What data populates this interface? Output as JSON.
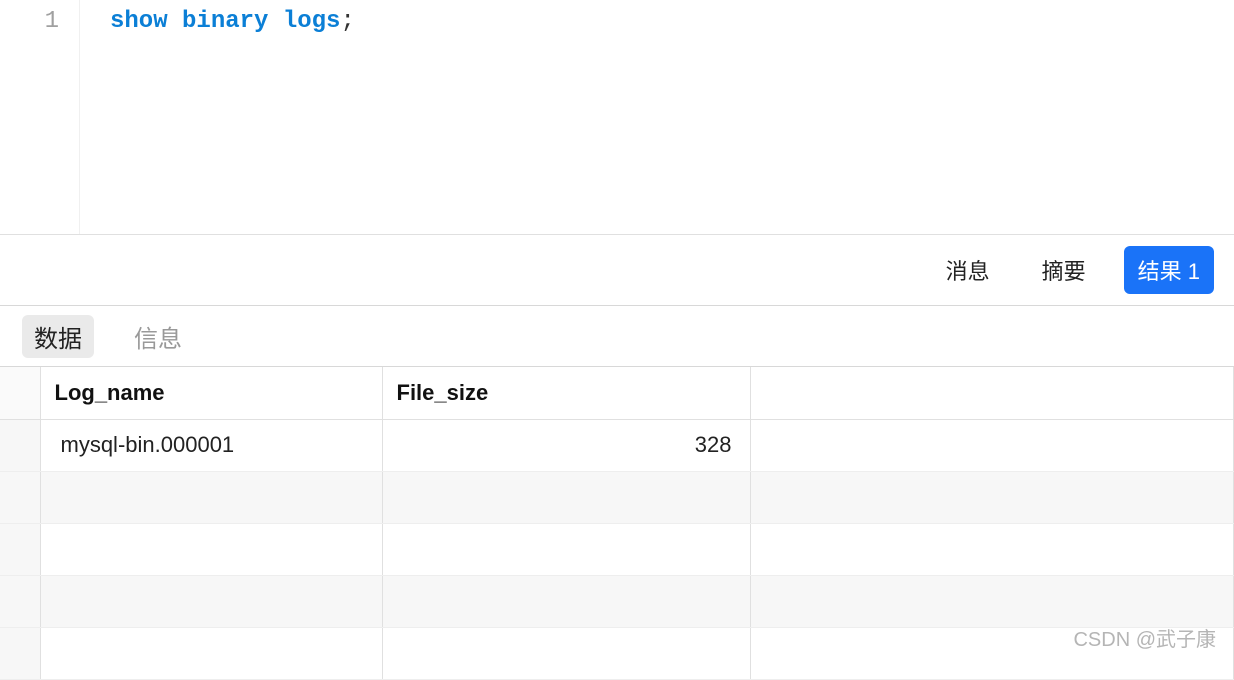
{
  "editor": {
    "line_number": "1",
    "sql_keywords": "show binary logs",
    "sql_punct": ";"
  },
  "result_tabs": {
    "messages": "消息",
    "summary": "摘要",
    "result": "结果 1"
  },
  "sub_tabs": {
    "data": "数据",
    "info": "信息"
  },
  "table": {
    "headers": {
      "log_name": "Log_name",
      "file_size": "File_size"
    },
    "rows": [
      {
        "log_name": "mysql-bin.000001",
        "file_size": "328"
      }
    ]
  },
  "watermark": "CSDN @武子康"
}
